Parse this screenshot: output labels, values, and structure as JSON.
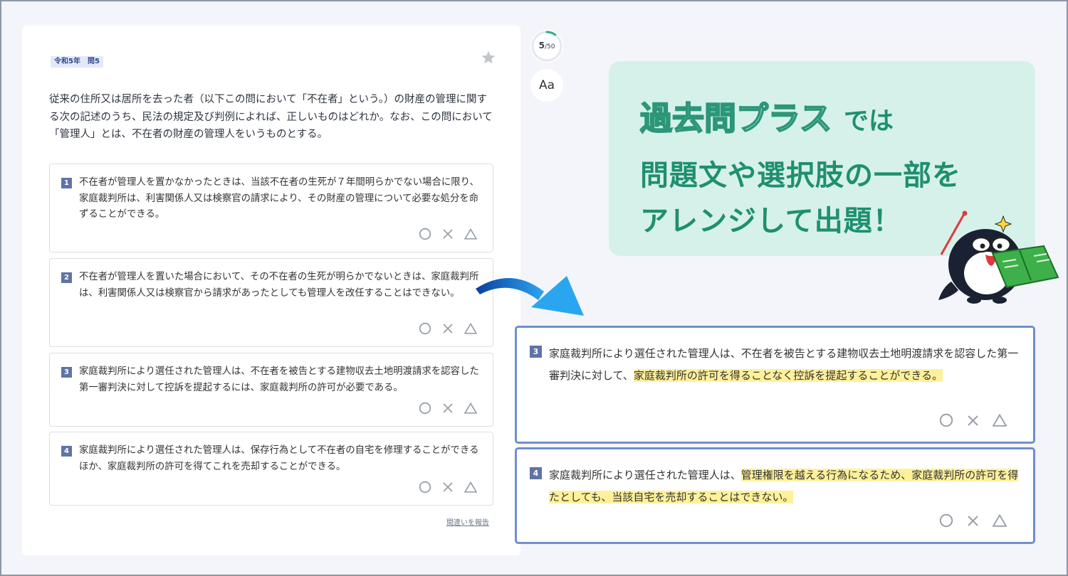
{
  "question_card": {
    "tag": "令和5年　問5",
    "question_text": "従来の住所又は居所を去った者（以下この問において「不在者」という。）の財産の管理に関する次の記述のうち、民法の規定及び判例によれば、正しいものはどれか。なお、この問において「管理人」とは、不在者の財産の管理人をいうものとする。",
    "choices": [
      {
        "num": "1",
        "text": "不在者が管理人を置かなかったときは、当該不在者の生死が７年間明らかでない場合に限り、家庭裁判所は、利害関係人又は検察官の請求により、その財産の管理について必要な処分を命ずることができる。"
      },
      {
        "num": "2",
        "text": "不在者が管理人を置いた場合において、その不在者の生死が明らかでないときは、家庭裁判所は、利害関係人又は検察官から請求があったとしても管理人を改任することはできない。"
      },
      {
        "num": "3",
        "text": "家庭裁判所により選任された管理人は、不在者を被告とする建物収去土地明渡請求を認容した第一審判決に対して控訴を提起するには、家庭裁判所の許可が必要である。"
      },
      {
        "num": "4",
        "text": "家庭裁判所により選任された管理人は、保存行為として不在者の自宅を修理することができるほか、家庭裁判所の許可を得てこれを売却することができる。"
      }
    ],
    "report_link": "間違いを報告"
  },
  "progress": {
    "current": "5",
    "total": "/50",
    "fraction": 0.1
  },
  "font_size_button": "Aa",
  "promo": {
    "brand": "過去問プラス",
    "brand_suffix": "では",
    "line1": "問題文や選択肢の一部を",
    "line2": "アレンジして出題！"
  },
  "arranged_choices": [
    {
      "num": "3",
      "text_plain": "家庭裁判所により選任された管理人は、不在者を被告とする建物収去土地明渡請求を認容した第一審判決に対して、",
      "text_highlight": "家庭裁判所の許可を得ることなく控訴を提起することができる。"
    },
    {
      "num": "4",
      "text_plain": "家庭裁判所により選任された管理人は、",
      "text_highlight": "管理権限を越える行為になるため、家庭裁判所の許可を得たとしても、当該自宅を売却することはできない。"
    }
  ],
  "colors": {
    "accent": "#1f8f6f",
    "highlight": "#fff19a",
    "arranged_border": "#6e8fd0",
    "number_badge": "#5f73a6"
  },
  "icons": {
    "mark_icons": [
      "circle-icon",
      "cross-icon",
      "triangle-icon"
    ],
    "favorite": "star-icon"
  }
}
